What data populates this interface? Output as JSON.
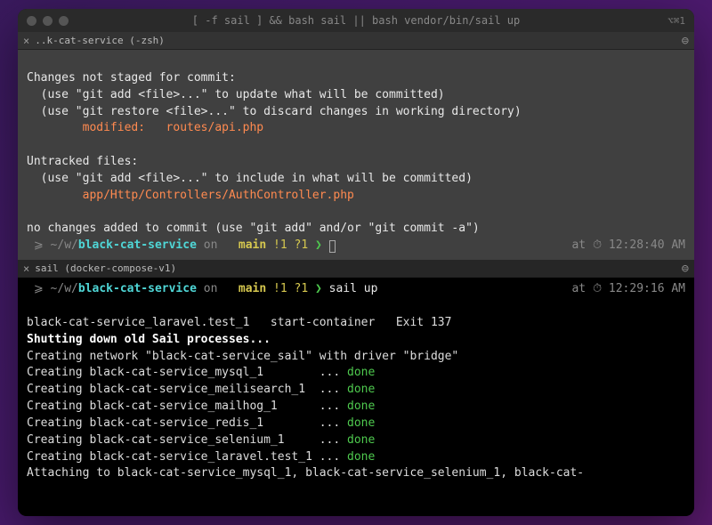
{
  "titlebar": {
    "title": "[ -f sail ] && bash sail || bash vendor/bin/sail up",
    "right_indicator": "⌥⌘1"
  },
  "pane_top": {
    "tab_label": "..k-cat-service (-zsh)",
    "lines": {
      "l1": "Changes not staged for commit:",
      "l2": "  (use \"git add <file>...\" to update what will be committed)",
      "l3": "  (use \"git restore <file>...\" to discard changes in working directory)",
      "mod_label": "        modified:   ",
      "mod_file": "routes/api.php",
      "l5": "Untracked files:",
      "l6": "  (use \"git add <file>...\" to include in what will be committed)",
      "untracked_file": "        app/Http/Controllers/AuthController.php",
      "l8": "no changes added to commit (use \"git add\" and/or \"git commit -a\")"
    },
    "prompt": {
      "apple": "",
      "pre_path": " ⩾ ~/w/",
      "repo": "black-cat-service",
      "on": " on ",
      "git_icons": " ",
      "branch": " main",
      "status": " !1 ?1",
      "arrow": " ❯ ",
      "at": "at ",
      "clock": "⏱ ",
      "time": "12:28:40 AM"
    }
  },
  "pane_bottom": {
    "tab_label": "sail (docker-compose-v1)",
    "prompt": {
      "apple": "",
      "pre_path": " ⩾ ~/w/",
      "repo": "black-cat-service",
      "on": " on ",
      "git_icons": " ",
      "branch": " main",
      "status": " !1 ?1",
      "arrow": " ❯ ",
      "cmd": "sail up",
      "at": "at ",
      "clock": "⏱ ",
      "time": "12:29:16 AM"
    },
    "out": {
      "l1a": "black-cat-service_laravel.test_1   start-container   Exit 137",
      "l2": "Shutting down old Sail processes...",
      "l3": "Creating network \"black-cat-service_sail\" with driver \"bridge\"",
      "c1a": "Creating black-cat-service_mysql_1        ... ",
      "c2a": "Creating black-cat-service_meilisearch_1  ... ",
      "c3a": "Creating black-cat-service_mailhog_1      ... ",
      "c4a": "Creating black-cat-service_redis_1        ... ",
      "c5a": "Creating black-cat-service_selenium_1     ... ",
      "c6a": "Creating black-cat-service_laravel.test_1 ... ",
      "done": "done",
      "l10": "Attaching to black-cat-service_mysql_1, black-cat-service_selenium_1, black-cat-"
    }
  }
}
